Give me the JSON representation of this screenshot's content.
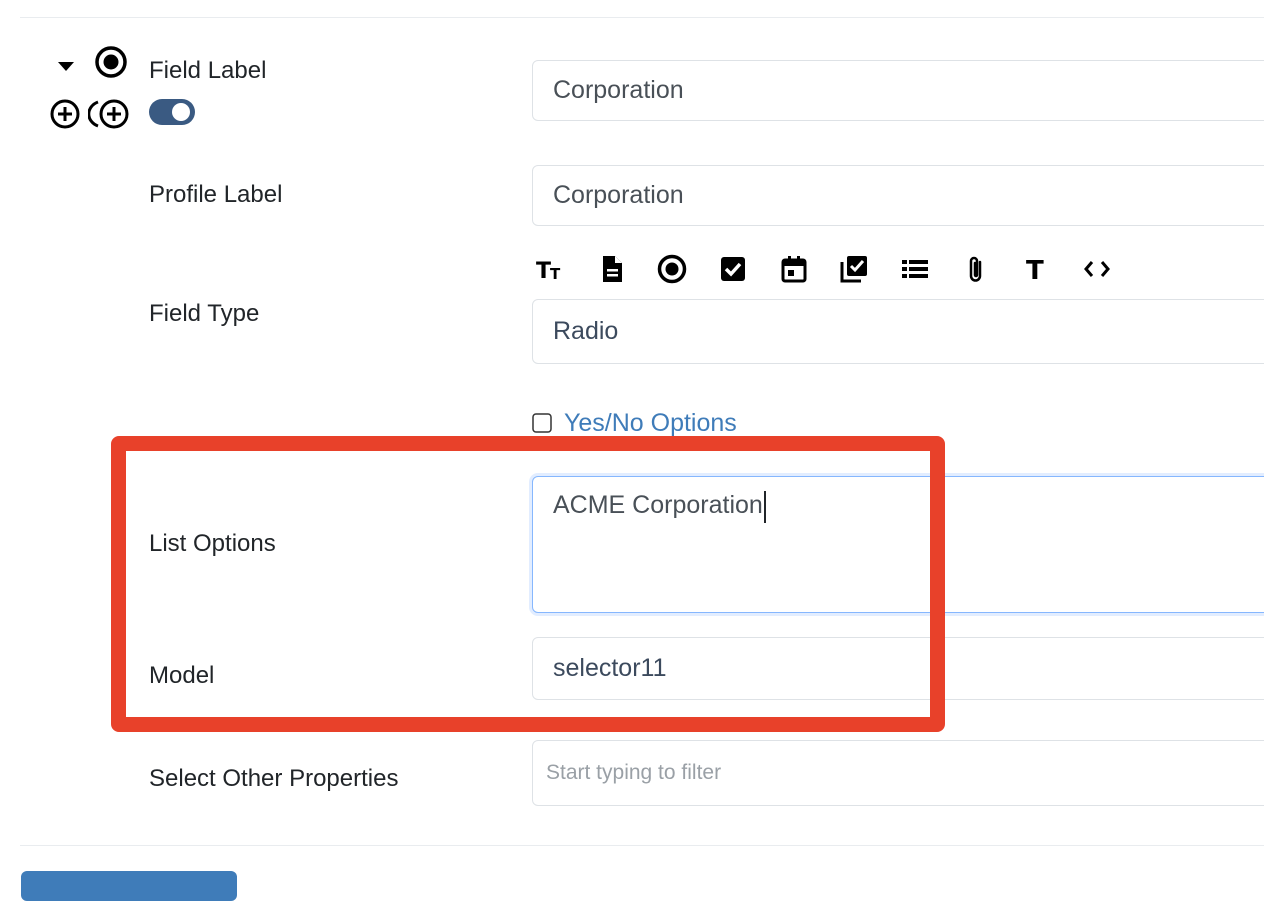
{
  "field_label": {
    "label": "Field Label",
    "value": "Corporation"
  },
  "profile_label": {
    "label": "Profile Label",
    "value": "Corporation"
  },
  "field_type": {
    "label": "Field Type",
    "value": "Radio",
    "type_icons": [
      "text-size-icon",
      "document-icon",
      "radio-icon",
      "checkbox-icon",
      "calendar-icon",
      "checklist-icon",
      "list-icon",
      "paperclip-icon",
      "text-icon",
      "code-icon"
    ]
  },
  "yes_no": {
    "label": "Yes/No Options",
    "checked": false
  },
  "list_options": {
    "label": "List Options",
    "value": "ACME Corporation"
  },
  "model": {
    "label": "Model",
    "value": "selector11"
  },
  "other_props": {
    "label": "Select Other Properties",
    "placeholder": "Start typing to filter"
  },
  "colors": {
    "accent": "#3f7cb9",
    "toggle": "#3a5a82",
    "highlight": "#e8412a",
    "focus_border": "#86b7fe"
  }
}
